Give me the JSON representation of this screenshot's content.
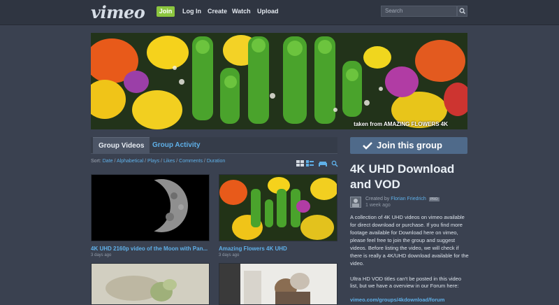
{
  "header": {
    "logo": "vimeo",
    "join": "Join",
    "nav": [
      "Log In",
      "Create",
      "Watch",
      "Upload"
    ],
    "search_placeholder": "Search"
  },
  "banner": {
    "caption": "taken from AMAZING FLOWERS 4K"
  },
  "tabs": {
    "videos": "Group Videos",
    "activity": "Group Activity"
  },
  "sort": {
    "label": "Sort:",
    "options": [
      "Date",
      "Alphabetical",
      "Plays",
      "Likes",
      "Comments",
      "Duration"
    ]
  },
  "videos": [
    {
      "title": "4K UHD 2160p video of the Moon with Pan...",
      "date": "3 days ago"
    },
    {
      "title": "Amazing Flowers 4K UHD",
      "date": "3 days ago"
    }
  ],
  "sidebar": {
    "join_button": "Join this group",
    "title": "4K UHD Download and VOD",
    "created_by": "Created by",
    "author": "Florian Friedrich",
    "badge": "PRO",
    "created_ago": "1 week ago",
    "description": "A collection of 4K UHD videos on vimeo available for direct download or purchase. If you find more footage available for Download here on vimeo, please feel free to join the group and suggest videos. Before listing the video, we will check if there is really a 4K/UHD download available for the video.",
    "description2": "Ultra HD VOD titles can't be posted in this video list, but we have a overview in our Forum here:",
    "forum_link": "vimeo.com/groups/4kdownload/forum"
  },
  "colors": {
    "accent_green": "#8cc63f",
    "link_blue": "#5fb0e8",
    "join_button": "#4f6a8a",
    "background": "#3a4150"
  }
}
